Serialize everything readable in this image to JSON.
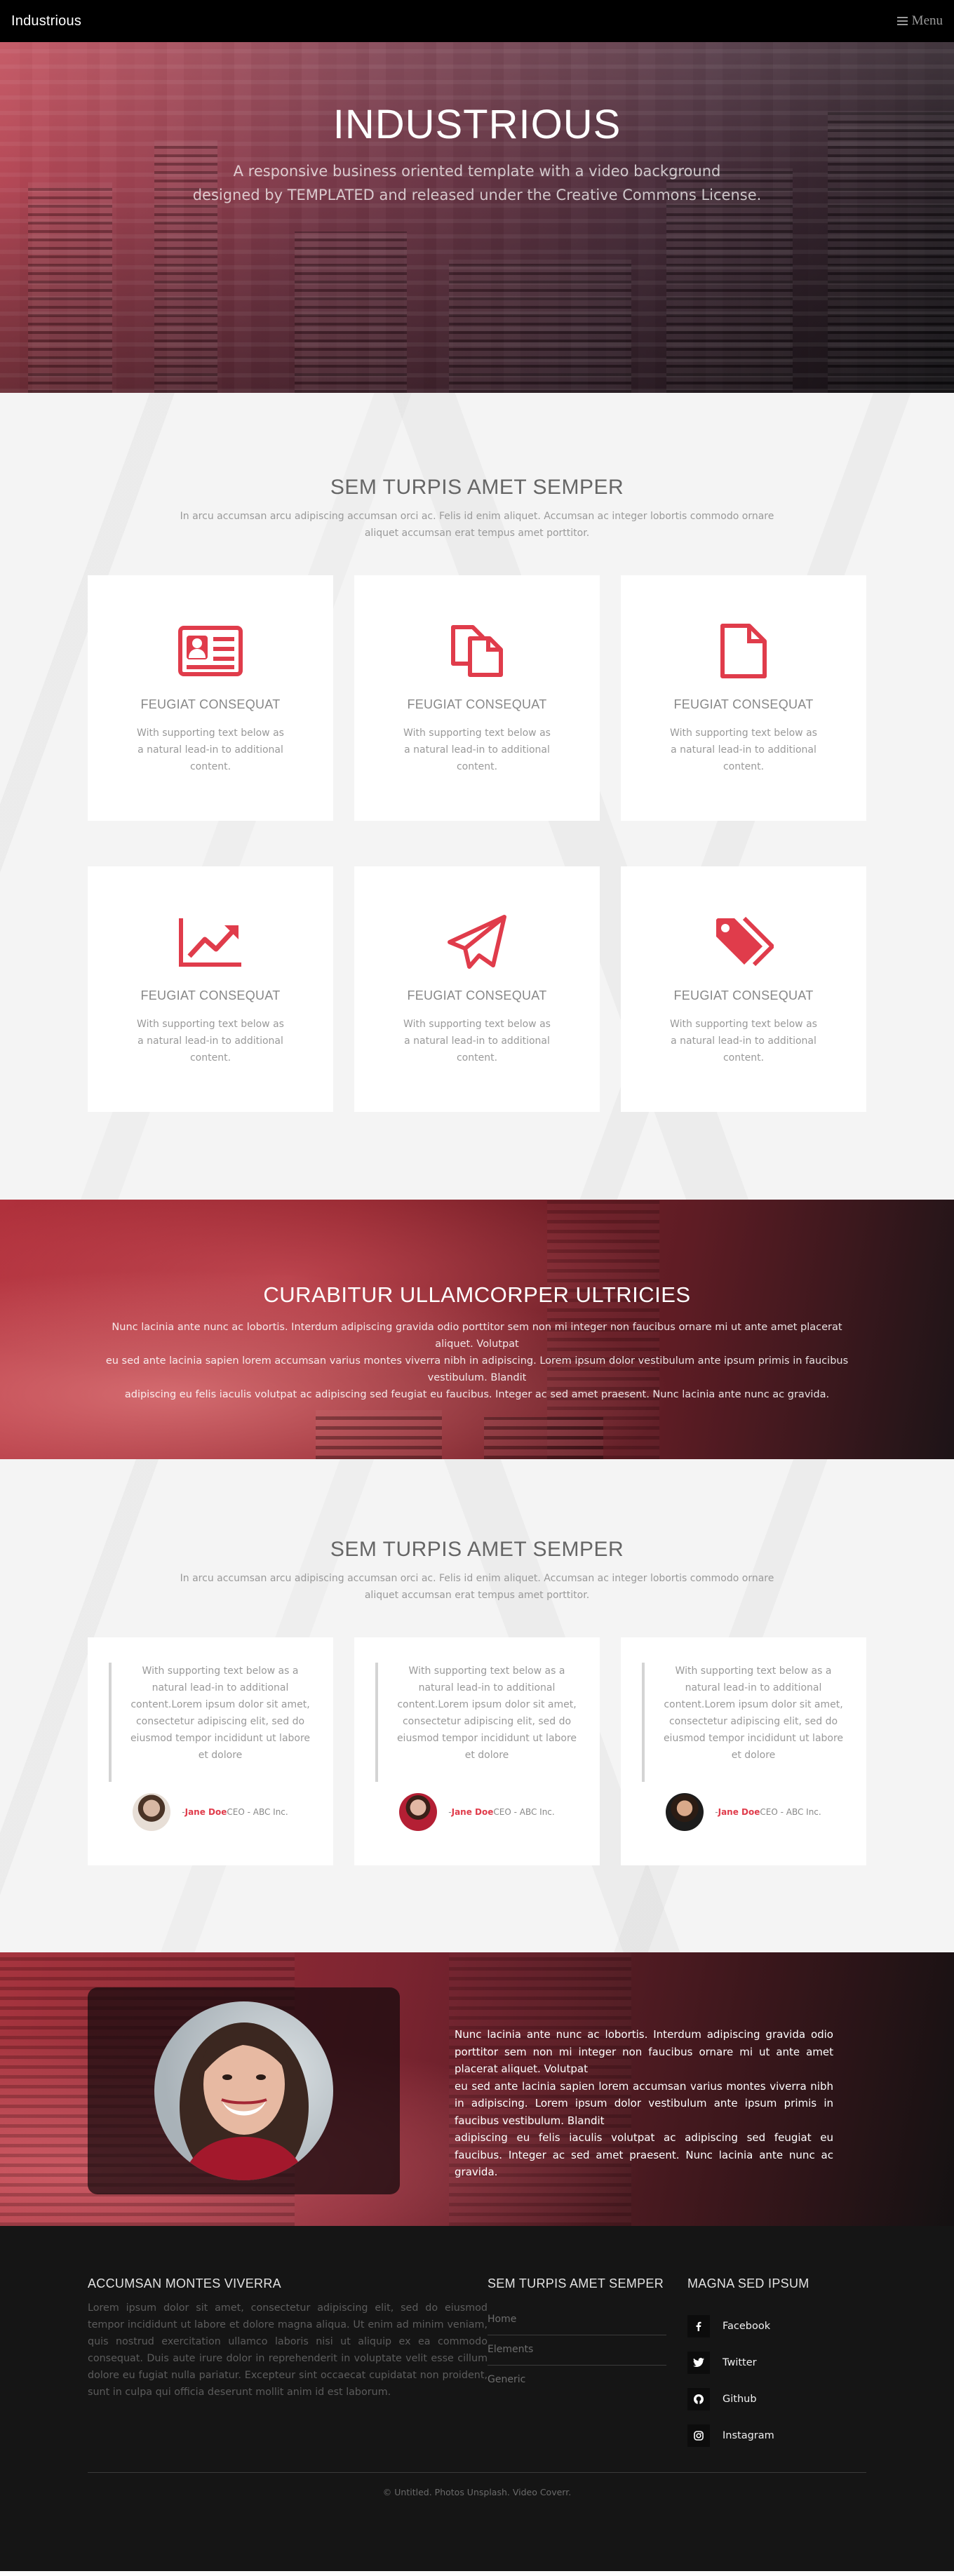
{
  "header": {
    "logo": "Industrious",
    "menu_label": "Menu"
  },
  "banner": {
    "title": "INDUSTRIOUS",
    "line1": "A responsive business oriented template with a video background",
    "line2": "designed by TEMPLATED and released under the Creative Commons License."
  },
  "features": {
    "title": "SEM TURPIS AMET SEMPER",
    "intro_line1": "In arcu accumsan arcu adipiscing accumsan orci ac. Felis id enim aliquet. Accumsan ac integer lobortis commodo ornare",
    "intro_line2": "aliquet accumsan erat tempus amet porttitor.",
    "items": [
      {
        "icon": "id-card-icon",
        "title": "FEUGIAT CONSEQUAT",
        "text": "With supporting text below as a natural lead-in to additional content."
      },
      {
        "icon": "copy-icon",
        "title": "FEUGIAT CONSEQUAT",
        "text": "With supporting text below as a natural lead-in to additional content."
      },
      {
        "icon": "file-icon",
        "title": "FEUGIAT CONSEQUAT",
        "text": "With supporting text below as a natural lead-in to additional content."
      },
      {
        "icon": "chart-line-icon",
        "title": "FEUGIAT CONSEQUAT",
        "text": "With supporting text below as a natural lead-in to additional content."
      },
      {
        "icon": "paper-plane-icon",
        "title": "FEUGIAT CONSEQUAT",
        "text": "With supporting text below as a natural lead-in to additional content."
      },
      {
        "icon": "tags-icon",
        "title": "FEUGIAT CONSEQUAT",
        "text": "With supporting text below as a natural lead-in to additional content."
      }
    ]
  },
  "cta": {
    "title": "CURABITUR ULLAMCORPER ULTRICIES",
    "line1": "Nunc lacinia ante nunc ac lobortis. Interdum adipiscing gravida odio porttitor sem non mi integer non faucibus ornare mi ut ante amet placerat aliquet. Volutpat",
    "line2": "eu sed ante lacinia sapien lorem accumsan varius montes viverra nibh in adipiscing. Lorem ipsum dolor vestibulum ante ipsum primis in faucibus vestibulum. Blandit",
    "line3": "adipiscing eu felis iaculis volutpat ac adipiscing sed feugiat eu faucibus. Integer ac sed amet praesent. Nunc lacinia ante nunc ac gravida."
  },
  "testimonials": {
    "title": "SEM TURPIS AMET SEMPER",
    "intro_line1": "In arcu accumsan arcu adipiscing accumsan orci ac. Felis id enim aliquet. Accumsan ac integer lobortis commodo ornare",
    "intro_line2": "aliquet accumsan erat tempus amet porttitor.",
    "items": [
      {
        "quote": "With supporting text below as a natural lead-in to additional content.Lorem ipsum dolor sit amet, consectetur adipiscing elit, sed do eiusmod tempor incididunt ut labore et dolore",
        "prefix": "- ",
        "name": "Jane Doe",
        "role": " CEO - ABC Inc."
      },
      {
        "quote": "With supporting text below as a natural lead-in to additional content.Lorem ipsum dolor sit amet, consectetur adipiscing elit, sed do eiusmod tempor incididunt ut labore et dolore",
        "prefix": "- ",
        "name": "Jane Doe",
        "role": " CEO - ABC Inc."
      },
      {
        "quote": "With supporting text below as a natural lead-in to additional content.Lorem ipsum dolor sit amet, consectetur adipiscing elit, sed do eiusmod tempor incididunt ut labore et dolore",
        "prefix": "- ",
        "name": "Jane Doe",
        "role": " CEO - ABC Inc."
      }
    ]
  },
  "profile": {
    "line1": "Nunc lacinia ante nunc ac lobortis. Interdum adipiscing gravida odio porttitor sem non mi integer non faucibus ornare mi ut ante amet placerat aliquet. Volutpat",
    "line2": "eu sed ante lacinia sapien lorem accumsan varius montes viverra nibh in adipiscing. Lorem ipsum dolor vestibulum ante ipsum primis in faucibus vestibulum. Blandit",
    "line3": "adipiscing eu felis iaculis volutpat ac adipiscing sed feugiat eu faucibus. Integer ac sed amet praesent. Nunc lacinia ante nunc ac gravida."
  },
  "footer": {
    "about_title": "ACCUMSAN MONTES VIVERRA",
    "about_text": "Lorem ipsum dolor sit amet, consectetur adipiscing elit, sed do eiusmod tempor incididunt ut labore et dolore magna aliqua. Ut enim ad minim veniam, quis nostrud exercitation ullamco laboris nisi ut aliquip ex ea commodo consequat. Duis aute irure dolor in reprehenderit in voluptate velit esse cillum dolore eu fugiat nulla pariatur. Excepteur sint occaecat cupidatat non proident, sunt in culpa qui officia deserunt mollit anim id est laborum.",
    "links_title": "SEM TURPIS AMET SEMPER",
    "links": [
      "Home",
      "Elements",
      "Generic"
    ],
    "social_title": "MAGNA SED IPSUM",
    "social": [
      {
        "icon": "facebook-icon",
        "label": "Facebook"
      },
      {
        "icon": "twitter-icon",
        "label": "Twitter"
      },
      {
        "icon": "github-icon",
        "label": "Github"
      },
      {
        "icon": "instagram-icon",
        "label": "Instagram"
      }
    ],
    "copyright": "© Untitled. Photos Unsplash. Video Coverr."
  },
  "colors": {
    "accent": "#e03c4b",
    "footer_bg": "#151515",
    "section_bg": "#f4f4f4"
  }
}
